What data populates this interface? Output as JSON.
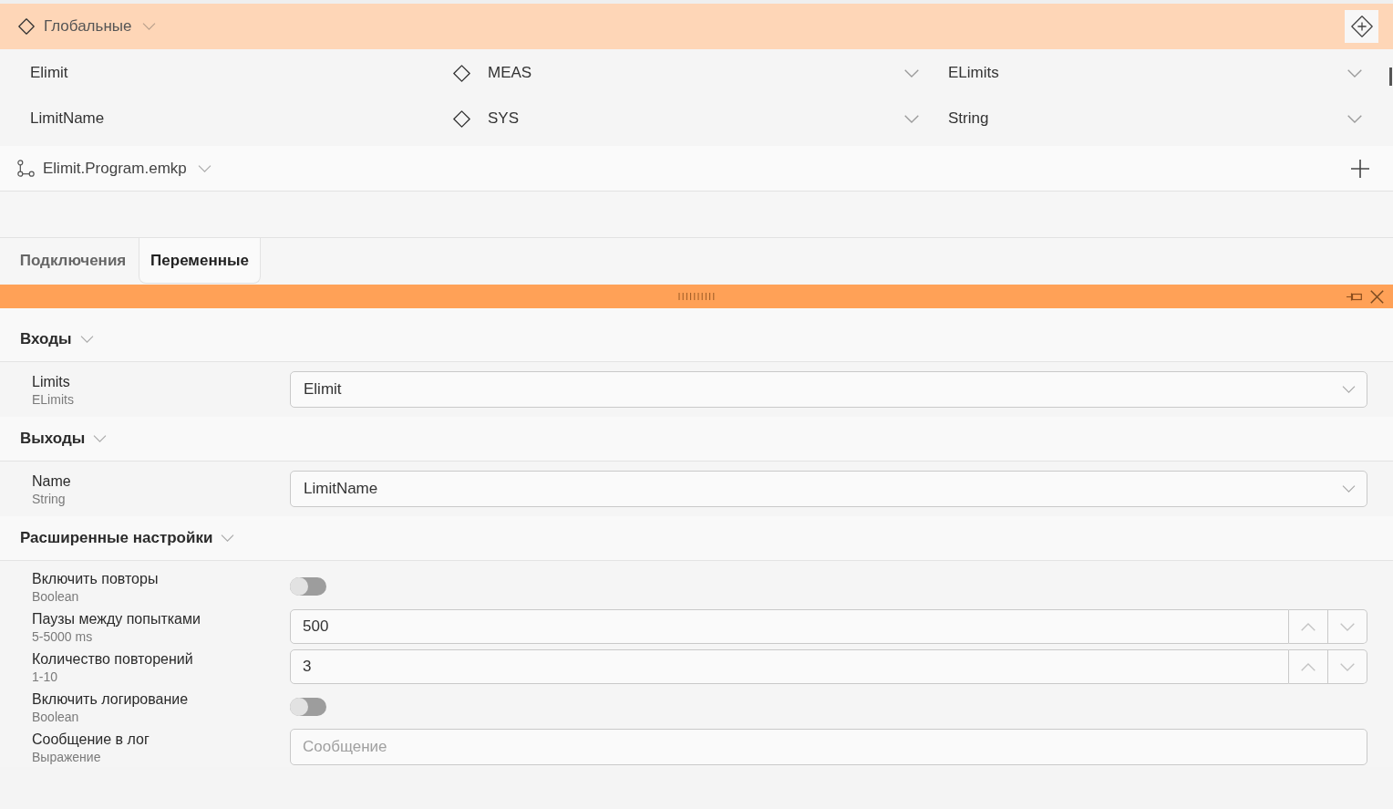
{
  "globals": {
    "title": "Глобальные",
    "expanded": true,
    "variables": [
      {
        "name": "Elimit",
        "scope": "MEAS",
        "type": "ELimits"
      },
      {
        "name": "LimitName",
        "scope": "SYS",
        "type": "String"
      }
    ]
  },
  "program": {
    "title": "Elimit.Program.emkp",
    "expanded": true
  },
  "tabs": [
    {
      "label": "Подключения",
      "selected": false
    },
    {
      "label": "Переменные",
      "selected": true
    }
  ],
  "panel": {
    "sections": [
      {
        "title": "Входы",
        "expanded": true,
        "fields": [
          {
            "kind": "dropdown",
            "label": "Limits",
            "sublabel": "ELimits",
            "value": "Elimit"
          }
        ]
      },
      {
        "title": "Выходы",
        "expanded": true,
        "fields": [
          {
            "kind": "dropdown",
            "label": "Name",
            "sublabel": "String",
            "value": "LimitName"
          }
        ]
      },
      {
        "title": "Расширенные настройки",
        "expanded": true,
        "fields": [
          {
            "kind": "toggle",
            "label": "Включить повторы",
            "sublabel": "Boolean",
            "on": false
          },
          {
            "kind": "number",
            "label": "Паузы между попытками",
            "sublabel": "5-5000 ms",
            "value": "500"
          },
          {
            "kind": "number",
            "label": "Количество повторений",
            "sublabel": "1-10",
            "value": "3"
          },
          {
            "kind": "toggle",
            "label": "Включить логирование",
            "sublabel": "Boolean",
            "on": false
          },
          {
            "kind": "text",
            "label": "Сообщение в лог",
            "sublabel": "Выражение",
            "placeholder": "Сообщение"
          }
        ]
      }
    ]
  }
}
